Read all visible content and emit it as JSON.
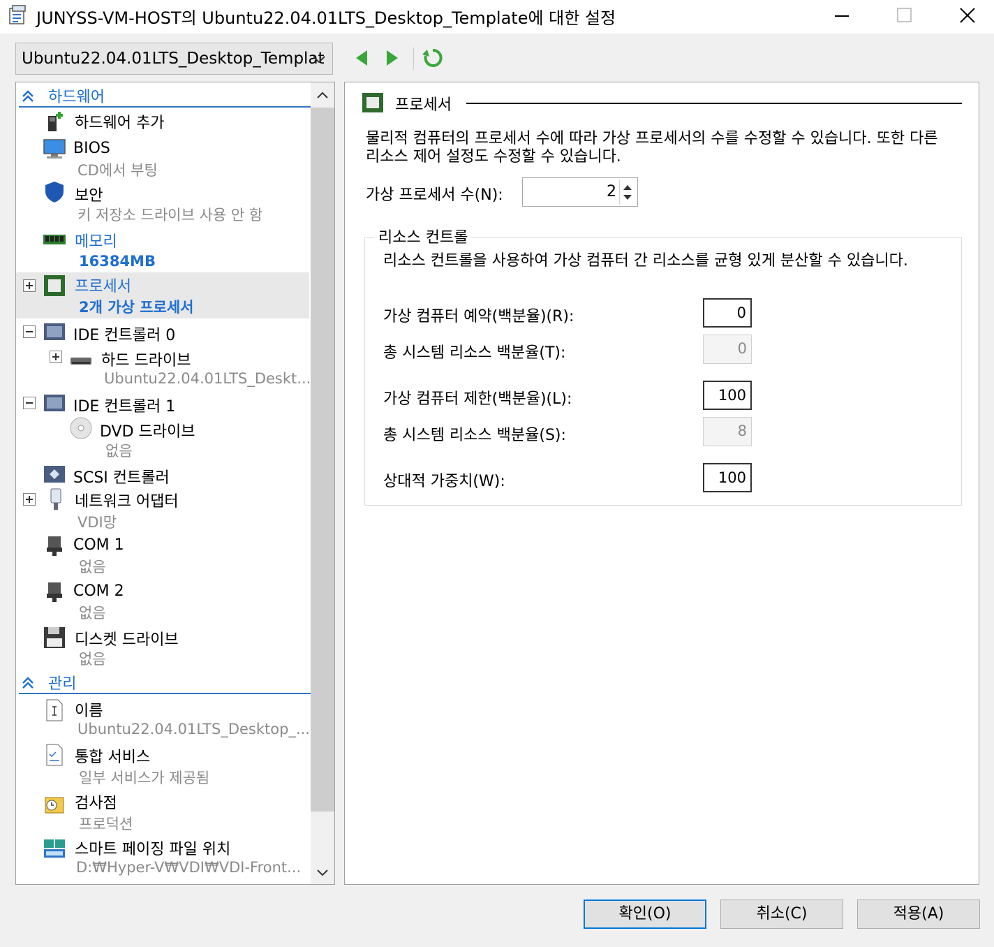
{
  "window": {
    "title": "JUNYSS-VM-HOST의 Ubuntu22.04.01LTS_Desktop_Template에 대한 설정"
  },
  "toolbar": {
    "vm_selected": "Ubuntu22.04.01LTS_Desktop_Templat"
  },
  "sidebar": {
    "hardware_header": "하드웨어",
    "management_header": "관리",
    "items": [
      {
        "label": "하드웨어 추가",
        "icon": "add-hardware-icon"
      },
      {
        "label": "BIOS",
        "sub": "CD에서 부팅",
        "icon": "bios-icon"
      },
      {
        "label": "보안",
        "sub": "키 저장소 드라이브 사용 안 함",
        "icon": "shield-icon"
      },
      {
        "label": "메모리",
        "sub": "16384MB",
        "icon": "memory-icon"
      },
      {
        "label": "프로세서",
        "sub": "2개 가상 프로세서",
        "icon": "processor-icon"
      },
      {
        "label": "IDE 컨트롤러 0",
        "icon": "ide-controller-icon"
      },
      {
        "label": "하드 드라이브",
        "sub": "Ubuntu22.04.01LTS_Deskt...",
        "icon": "hard-drive-icon"
      },
      {
        "label": "IDE 컨트롤러 1",
        "icon": "ide-controller-icon"
      },
      {
        "label": "DVD 드라이브",
        "sub": "없음",
        "icon": "dvd-icon"
      },
      {
        "label": "SCSI 컨트롤러",
        "icon": "scsi-controller-icon"
      },
      {
        "label": "네트워크 어댑터",
        "sub": "VDI망",
        "icon": "network-adapter-icon"
      },
      {
        "label": "COM 1",
        "sub": "없음",
        "icon": "com-port-icon"
      },
      {
        "label": "COM 2",
        "sub": "없음",
        "icon": "com-port-icon"
      },
      {
        "label": "디스켓 드라이브",
        "sub": "없음",
        "icon": "floppy-icon"
      },
      {
        "label": "이름",
        "sub": "Ubuntu22.04.01LTS_Desktop_...",
        "icon": "name-icon"
      },
      {
        "label": "통합 서비스",
        "sub": "일부 서비스가 제공됨",
        "icon": "integration-services-icon"
      },
      {
        "label": "검사점",
        "sub": "프로덕션",
        "icon": "checkpoint-icon"
      },
      {
        "label": "스마트 페이징 파일 위치",
        "sub": "D:₩Hyper-V₩VDI₩VDI-Front...",
        "icon": "smart-paging-icon"
      }
    ]
  },
  "processor": {
    "header": "프로세서",
    "description": "물리적 컴퓨터의 프로세서 수에 따라 가상 프로세서의 수를 수정할 수 있습니다. 또한 다른 리소스 제어 설정도 수정할 수 있습니다.",
    "vp_label": "가상 프로세서 수(N):",
    "vp_value": "2",
    "resource_control": {
      "title": "리소스 컨트롤",
      "description": "리소스 컨트롤을 사용하여 가상 컴퓨터 간 리소스를 균형 있게 분산할 수 있습니다.",
      "fields": [
        {
          "label": "가상 컴퓨터 예약(백분율)(R):",
          "value": "0"
        },
        {
          "label": "총 시스템 리소스 백분율(T):",
          "value": "0"
        },
        {
          "label": "가상 컴퓨터 제한(백분율)(L):",
          "value": "100"
        },
        {
          "label": "총 시스템 리소스 백분율(S):",
          "value": "8"
        },
        {
          "label": "상대적 가중치(W):",
          "value": "100"
        }
      ]
    }
  },
  "buttons": {
    "ok": "확인(O)",
    "cancel": "취소(C)",
    "apply": "적용(A)"
  },
  "colors": {
    "accent": "#1e6fd0",
    "nav_arrow": "#3aa63a",
    "selection": "#e8e8e8"
  }
}
